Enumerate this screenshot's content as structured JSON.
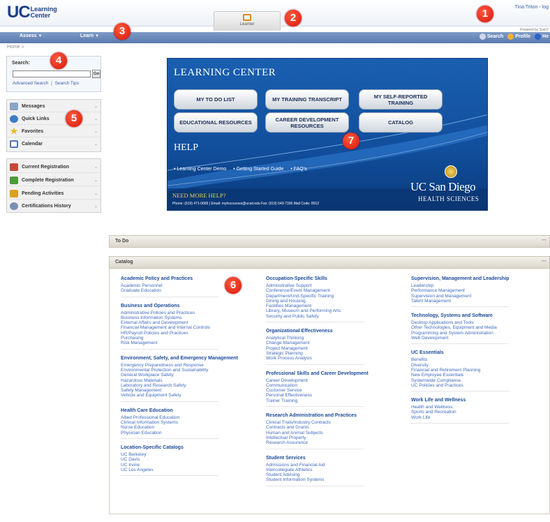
{
  "header": {
    "logo_main": "UC",
    "logo_sub": "Learning Center",
    "role_tab_label": "Learner",
    "user_line": "Tina Triton - log",
    "powered_by": "Powered by SumT"
  },
  "nav": {
    "left": [
      "Assess",
      "Learn"
    ],
    "right": [
      "Search",
      "Profile",
      "He"
    ]
  },
  "breadcrumb": "Home »",
  "search": {
    "title": "Search:",
    "input_value": "",
    "go_label": "Go",
    "advanced_label": "Advanced Search",
    "separator": "|",
    "tips_label": "Search Tips"
  },
  "widgets": [
    {
      "label": "Messages",
      "icon": "messages-icon",
      "color": "#8aa3c8"
    },
    {
      "label": "Quick Links",
      "icon": "globe-icon",
      "color": "#3d7bc7"
    },
    {
      "label": "Favorites",
      "icon": "star-icon",
      "color": "#e8b820"
    },
    {
      "label": "Calendar",
      "icon": "calendar-icon",
      "color": "#4f77b5"
    }
  ],
  "registration": [
    {
      "label": "Current Registration",
      "icon": "pencil-icon",
      "color": "#c44a3a"
    },
    {
      "label": "Complete Registration",
      "icon": "check-pencil-icon",
      "color": "#4f9a3a"
    },
    {
      "label": "Pending Activities",
      "icon": "flag-icon",
      "color": "#d9a21a"
    },
    {
      "label": "Certifications History",
      "icon": "certificate-icon",
      "color": "#7a8fb0"
    }
  ],
  "banner": {
    "title": "LEARNING CENTER",
    "buttons": [
      "MY TO DO LIST",
      "MY TRAINING TRANSCRIPT",
      "MY SELF-REPORTED TRAINING",
      "EDUCATIONAL RESOURCES",
      "CAREER DEVELOPMENT RESOURCES",
      "CATALOG"
    ],
    "help_title": "HELP",
    "help_links": [
      "• Learning Center Demo",
      "• Getting Started Guide",
      "• FAQ's"
    ],
    "need_help": "NEED MORE HELP?",
    "contact": "Phone: (619) 471-0665 | Email: myhscourses@ucsd.edu Fax: (619) 543-7336 Mail Code: 8912",
    "org_name": "UC San Diego",
    "org_sub": "HEALTH SCIENCES"
  },
  "todo_title": "To Do",
  "catalog_title": "Catalog",
  "catalog_columns": [
    [
      {
        "head": "Academic Policy and Practices",
        "items": [
          "Academic Personnel",
          "Graduate Education"
        ]
      },
      {
        "head": "Business and Operations",
        "items": [
          "Administrative Policies and Practices",
          "Business Information Systems",
          "External Affairs and Development",
          "Financial Management and Internal Controls",
          "HR/Payroll Policies and Practices",
          "Purchasing",
          "Risk Management"
        ]
      },
      {
        "head": "Environment, Safety, and Emergency Management",
        "items": [
          "Emergency Preparedness and Response",
          "Environmental Protection and Sustainability",
          "General Workplace Safety",
          "Hazardous Materials",
          "Laboratory and Research Safety",
          "Safety Management",
          "Vehicle and Equipment Safety"
        ]
      },
      {
        "head": "Health Care Education",
        "items": [
          "Allied Professional Education",
          "Clinical Information Systems",
          "Nurse Education",
          "Physician Education"
        ]
      },
      {
        "head": "Location-Specific Catalogs",
        "items": [
          "UC Berkeley",
          "UC Davis",
          "UC Irvine",
          "UC Los Angeles"
        ]
      }
    ],
    [
      {
        "head": "Occupation-Specific Skills",
        "items": [
          "Administrative Support",
          "Conference/Event Management",
          "Department/Unit-Specific Training",
          "Dining and Housing",
          "Facilities Management",
          "Library, Museum and Performing Arts",
          "Security and Public Safety"
        ]
      },
      {
        "head": "Organizational Effectiveness",
        "items": [
          "Analytical Thinking",
          "Change Management",
          "Project Management",
          "Strategic Planning",
          "Work Process Analysis"
        ]
      },
      {
        "head": "Professional Skills and Career Development",
        "items": [
          "Career Development",
          "Communication",
          "Customer Service",
          "Personal Effectiveness",
          "Trainer Training"
        ]
      },
      {
        "head": "Research Administration and Practices",
        "items": [
          "Clinical Trials/Industry Contracts",
          "Contracts and Grants",
          "Human and Animal Subjects",
          "Intellectual Property",
          "Research Assurance"
        ]
      },
      {
        "head": "Student Services",
        "items": [
          "Admissions and Financial Aid",
          "Intercollegiate Athletics",
          "Student Advising",
          "Student Information Systems"
        ]
      }
    ],
    [
      {
        "head": "Supervision, Management and Leadership",
        "items": [
          "Leadership",
          "Performance Management",
          "Supervision and Management",
          "Talent Management"
        ]
      },
      {
        "head": "Technology, Systems and Software",
        "items": [
          "Desktop Applications and Tools",
          "Other Technologies, Equipment and Media",
          "Programming and System Administration",
          "Web Development"
        ]
      },
      {
        "head": "UC Essentials",
        "items": [
          "Benefits",
          "Diversity",
          "Financial and Retirement Planning",
          "New Employee Essentials",
          "Systemwide Compliance",
          "UC Policies and Practices"
        ]
      },
      {
        "head": "Work Life and Wellness",
        "items": [
          "Health and Wellness",
          "Sports and Recreation",
          "Work Life"
        ]
      }
    ]
  ],
  "callouts": [
    "1",
    "2",
    "3",
    "4",
    "5",
    "6",
    "7"
  ]
}
